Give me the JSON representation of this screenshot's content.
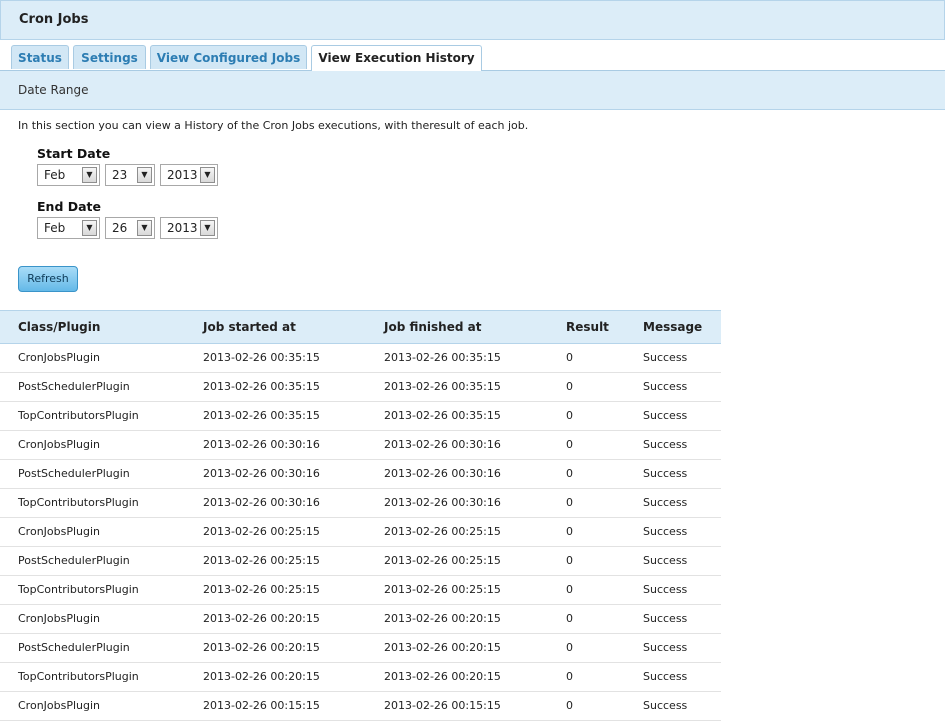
{
  "page": {
    "title": "Cron Jobs"
  },
  "tabs": [
    {
      "label": "Status"
    },
    {
      "label": "Settings"
    },
    {
      "label": "View Configured Jobs"
    },
    {
      "label": "View Execution History"
    }
  ],
  "section": {
    "title": "Date Range",
    "intro": "In this section you can view a History of the Cron Jobs executions, with theresult of each job."
  },
  "start_date": {
    "label": "Start Date",
    "month": "Feb",
    "day": "23",
    "year": "2013"
  },
  "end_date": {
    "label": "End Date",
    "month": "Feb",
    "day": "26",
    "year": "2013"
  },
  "refresh_label": "Refresh",
  "table": {
    "headers": [
      "Class/Plugin",
      "Job started at",
      "Job finished at",
      "Result",
      "Message"
    ],
    "rows": [
      [
        "CronJobsPlugin",
        "2013-02-26 00:35:15",
        "2013-02-26 00:35:15",
        "0",
        "Success"
      ],
      [
        "PostSchedulerPlugin",
        "2013-02-26 00:35:15",
        "2013-02-26 00:35:15",
        "0",
        "Success"
      ],
      [
        "TopContributorsPlugin",
        "2013-02-26 00:35:15",
        "2013-02-26 00:35:15",
        "0",
        "Success"
      ],
      [
        "CronJobsPlugin",
        "2013-02-26 00:30:16",
        "2013-02-26 00:30:16",
        "0",
        "Success"
      ],
      [
        "PostSchedulerPlugin",
        "2013-02-26 00:30:16",
        "2013-02-26 00:30:16",
        "0",
        "Success"
      ],
      [
        "TopContributorsPlugin",
        "2013-02-26 00:30:16",
        "2013-02-26 00:30:16",
        "0",
        "Success"
      ],
      [
        "CronJobsPlugin",
        "2013-02-26 00:25:15",
        "2013-02-26 00:25:15",
        "0",
        "Success"
      ],
      [
        "PostSchedulerPlugin",
        "2013-02-26 00:25:15",
        "2013-02-26 00:25:15",
        "0",
        "Success"
      ],
      [
        "TopContributorsPlugin",
        "2013-02-26 00:25:15",
        "2013-02-26 00:25:15",
        "0",
        "Success"
      ],
      [
        "CronJobsPlugin",
        "2013-02-26 00:20:15",
        "2013-02-26 00:20:15",
        "0",
        "Success"
      ],
      [
        "PostSchedulerPlugin",
        "2013-02-26 00:20:15",
        "2013-02-26 00:20:15",
        "0",
        "Success"
      ],
      [
        "TopContributorsPlugin",
        "2013-02-26 00:20:15",
        "2013-02-26 00:20:15",
        "0",
        "Success"
      ],
      [
        "CronJobsPlugin",
        "2013-02-26 00:15:15",
        "2013-02-26 00:15:15",
        "0",
        "Success"
      ]
    ]
  }
}
